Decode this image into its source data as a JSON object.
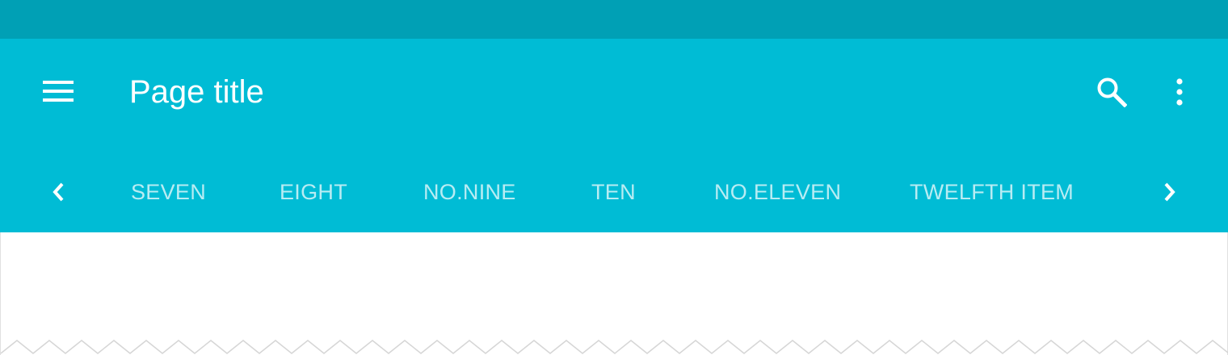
{
  "app_bar": {
    "title": "Page title",
    "menu_icon": "menu-icon",
    "search_icon": "search-icon",
    "more_icon": "more-vert-icon",
    "color": "#00BCD5",
    "status_bar_color": "#00A0B5"
  },
  "tabs": {
    "left_arrow_icon": "chevron-left-icon",
    "right_arrow_icon": "chevron-right-icon",
    "items": [
      {
        "label": "SEVEN"
      },
      {
        "label": "EIGHT"
      },
      {
        "label": "NO.NINE"
      },
      {
        "label": "TEN"
      },
      {
        "label": "NO.ELEVEN"
      },
      {
        "label": "TWELFTH ITEM"
      }
    ]
  }
}
